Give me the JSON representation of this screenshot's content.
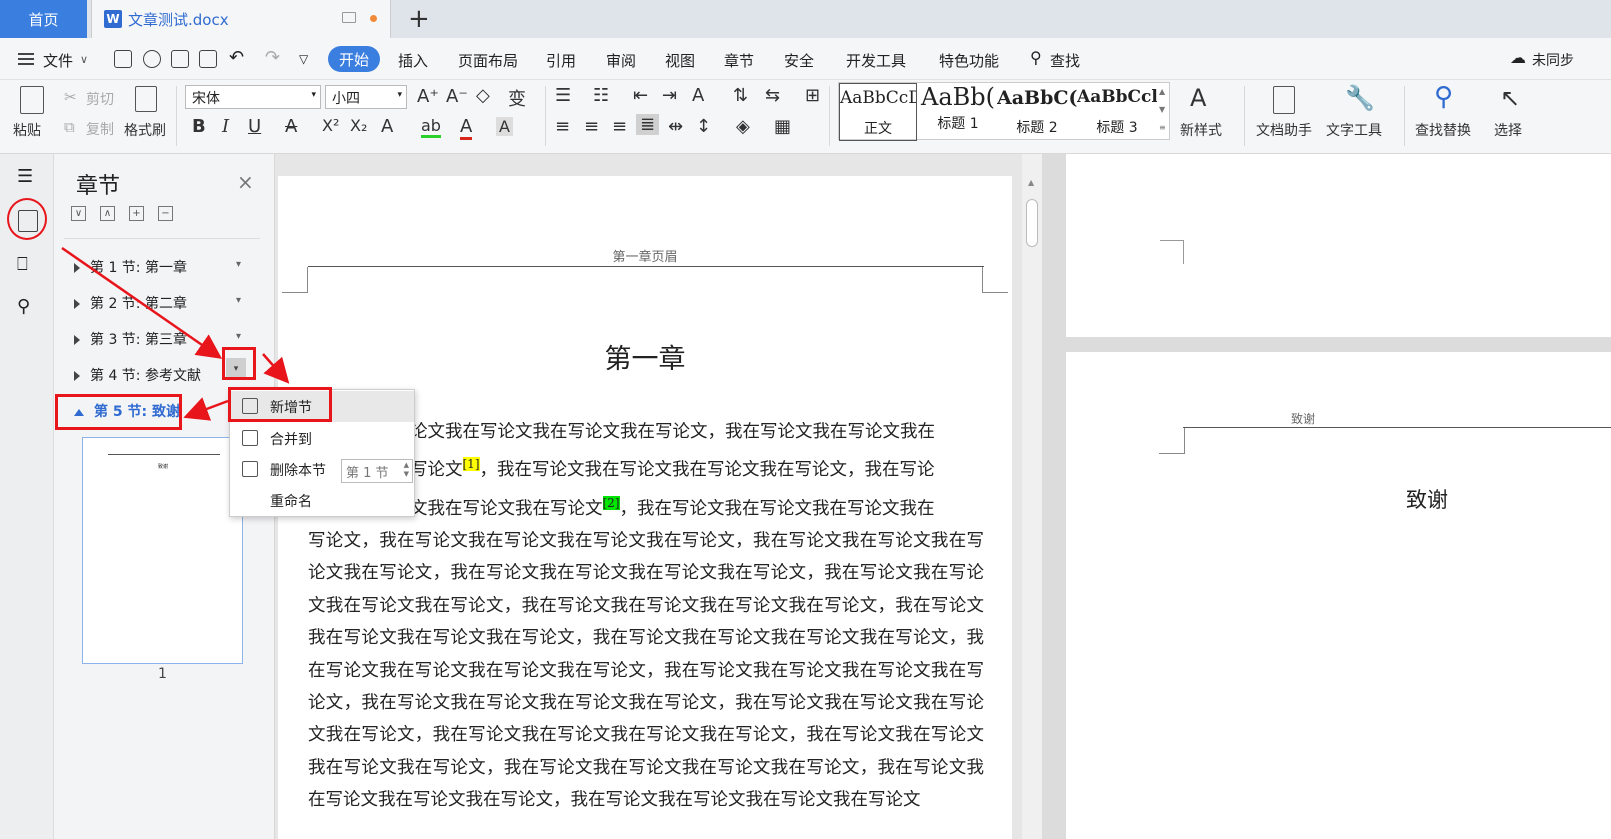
{
  "titlebar": {
    "home_tab": "首页",
    "doc_tab": "文章测试.docx",
    "doc_icon": "W"
  },
  "menu": {
    "file": "文件",
    "tabs": [
      "开始",
      "插入",
      "页面布局",
      "引用",
      "审阅",
      "视图",
      "章节",
      "安全",
      "开发工具",
      "特色功能"
    ],
    "search": "查找",
    "sync": "未同步"
  },
  "ribbon": {
    "paste": "粘贴",
    "cut": "剪切",
    "copy": "复制",
    "format_painter": "格式刷",
    "font_name": "宋体",
    "font_size": "小四",
    "styles": [
      {
        "preview": "AaBbCcDd",
        "label": "正文"
      },
      {
        "preview": "AaBb(",
        "label": "标题 1"
      },
      {
        "preview": "AaBbC(",
        "label": "标题 2"
      },
      {
        "preview": "AaBbCcl",
        "label": "标题 3"
      }
    ],
    "new_style": "新样式",
    "doc_helper": "文档助手",
    "text_tools": "文字工具",
    "find_replace": "查找替换",
    "select": "选择"
  },
  "nav": {
    "title": "章节",
    "sections": [
      "第 1 节: 第一章",
      "第 2 节: 第二章",
      "第 3 节: 第三章",
      "第 4 节: 参考文献",
      "第 5 节: 致谢"
    ],
    "thumb_title": "致谢",
    "page_number": "1"
  },
  "context_menu": {
    "add_section": "新增节",
    "merge_to": "合并到",
    "merge_target": "第 1 节",
    "delete_section": "删除本节",
    "rename": "重命名"
  },
  "document": {
    "header": "第一章页眉",
    "title": "第一章",
    "para_start": "论文我在写论文我在写论文我在写论文，我在写论文我在写论文我在",
    "line2_a": "写论文",
    "ref1": "[1]",
    "line2_b": "，我在写论文我在写论文我在写论文我在写论文，我在写论",
    "line3_a": "文我在写论文我在写论文",
    "ref2": "[2]",
    "line3_b": "，我在写论文我在写论文我在写论文我在",
    "body": "写论文，我在写论文我在写论文我在写论文我在写论文，我在写论文我在写论文我在写论文我在写论文，我在写论文我在写论文我在写论文我在写论文，我在写论文我在写论文我在写论文我在写论文，我在写论文我在写论文我在写论文我在写论文，我在写论文我在写论文我在写论文我在写论文，我在写论文我在写论文我在写论文我在写论文，我在写论文我在写论文我在写论文我在写论文，我在写论文我在写论文我在写论文我在写论文，我在写论文我在写论文我在写论文我在写论文，我在写论文我在写论文我在写论文我在写论文，我在写论文我在写论文我在写论文我在写论文，我在写论文我在写论文我在写论文我在写论文，我在写论文我在写论文我在写论文我在写论文，我在写论文我在写论文我在写论文我在写论文，我在写论文我在写论文我在写论文我在写论文"
  },
  "right_page": {
    "header": "致谢",
    "title": "致谢"
  },
  "colors": {
    "accent": "#3a7ee0",
    "annotation": "#e8151b",
    "highlight_yellow": "#ffff00",
    "highlight_green": "#00e600"
  }
}
